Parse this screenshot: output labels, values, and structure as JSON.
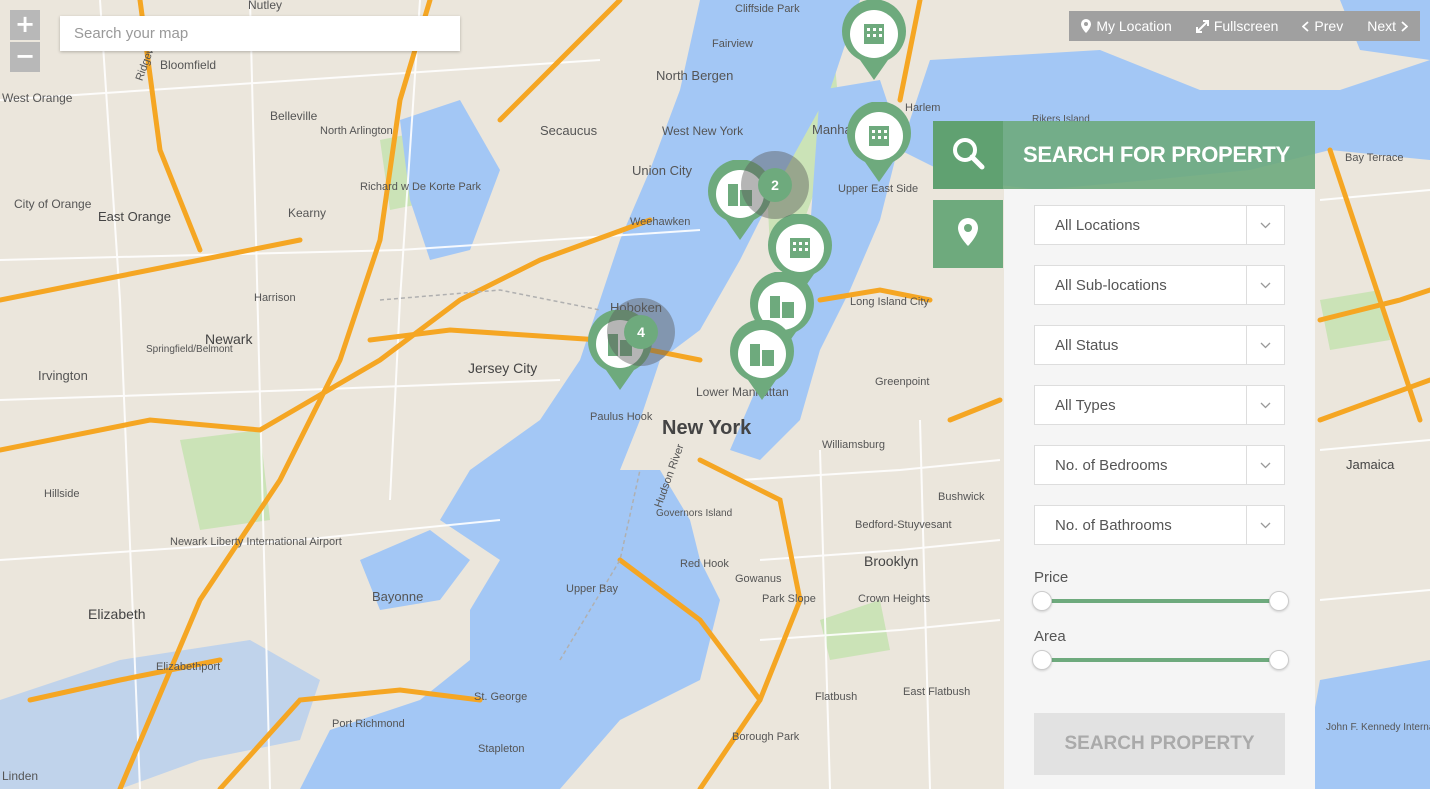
{
  "map": {
    "search_placeholder": "Search your map",
    "zoom_in": "+",
    "zoom_out": "−",
    "labels": [
      {
        "text": "New York",
        "size": 20,
        "bold": true,
        "cls": "city"
      },
      {
        "text": "Manhattan",
        "size": 13
      },
      {
        "text": "Brooklyn",
        "size": 14
      },
      {
        "text": "Jersey City",
        "size": 14
      },
      {
        "text": "Hoboken",
        "size": 13
      },
      {
        "text": "Newark",
        "size": 14
      },
      {
        "text": "Bayonne",
        "size": 13
      },
      {
        "text": "Elizabeth",
        "size": 14
      },
      {
        "text": "Union City",
        "size": 13
      },
      {
        "text": "Secaucus",
        "size": 13
      },
      {
        "text": "North Bergen",
        "size": 13
      },
      {
        "text": "West New York",
        "size": 12
      },
      {
        "text": "East Orange",
        "size": 13
      },
      {
        "text": "Bloomfield",
        "size": 12
      },
      {
        "text": "West Orange",
        "size": 12
      },
      {
        "text": "Irvington",
        "size": 13
      },
      {
        "text": "Kearny",
        "size": 12
      },
      {
        "text": "Harrison",
        "size": 11
      },
      {
        "text": "Belleville",
        "size": 12
      },
      {
        "text": "Nutley",
        "size": 12
      },
      {
        "text": "Fairview",
        "size": 11
      },
      {
        "text": "Cliffside Park",
        "size": 11
      },
      {
        "text": "Weehawken",
        "size": 11
      },
      {
        "text": "Lower Manhattan",
        "size": 12
      },
      {
        "text": "Williamsburg",
        "size": 11
      },
      {
        "text": "Greenpoint",
        "size": 11
      },
      {
        "text": "Long Island City",
        "size": 11
      },
      {
        "text": "Jamaica",
        "size": 13
      },
      {
        "text": "Red Hook",
        "size": 11
      },
      {
        "text": "Governors Island",
        "size": 10
      },
      {
        "text": "Upper Bay",
        "size": 11
      },
      {
        "text": "Newark Liberty International Airport",
        "size": 11
      },
      {
        "text": "John F. Kennedy International Airport",
        "size": 10
      },
      {
        "text": "Bedford-Stuyvesant",
        "size": 11
      },
      {
        "text": "Crown Heights",
        "size": 11
      },
      {
        "text": "Flatbush",
        "size": 11
      },
      {
        "text": "Park Slope",
        "size": 11
      },
      {
        "text": "Elizabethport",
        "size": 11
      },
      {
        "text": "Hillside",
        "size": 11
      },
      {
        "text": "Paulus Hook",
        "size": 11
      },
      {
        "text": "Upper East Side",
        "size": 11
      },
      {
        "text": "Harlem",
        "size": 11
      },
      {
        "text": "Rikers Island",
        "size": 10
      },
      {
        "text": "Port Richmond",
        "size": 11
      },
      {
        "text": "St. George",
        "size": 11
      },
      {
        "text": "Bay Terrace",
        "size": 11
      },
      {
        "text": "Richard w De Korte Park",
        "size": 11
      },
      {
        "text": "North Arlington",
        "size": 11
      },
      {
        "text": "City of Orange",
        "size": 12
      },
      {
        "text": "Springfield/Belmont",
        "size": 10
      },
      {
        "text": "Hudson River",
        "size": 11
      },
      {
        "text": "Linden",
        "size": 12
      },
      {
        "text": "Gowanus",
        "size": 11
      },
      {
        "text": "Bushwick",
        "size": 11
      },
      {
        "text": "East Flatbush",
        "size": 11
      },
      {
        "text": "Borough Park",
        "size": 11
      },
      {
        "text": "Ridgewood",
        "size": 11
      },
      {
        "text": "Stapleton",
        "size": 11
      }
    ],
    "clusters": [
      {
        "count": "2"
      },
      {
        "count": "4"
      }
    ]
  },
  "toolbar": {
    "my_location": "My Location",
    "fullscreen": "Fullscreen",
    "prev": "Prev",
    "next": "Next"
  },
  "search_panel": {
    "title": "SEARCH FOR PROPERTY",
    "selects": [
      {
        "label": "All Locations"
      },
      {
        "label": "All Sub-locations"
      },
      {
        "label": "All Status"
      },
      {
        "label": "All Types"
      },
      {
        "label": "No. of Bedrooms"
      },
      {
        "label": "No. of Bathrooms"
      }
    ],
    "price_label": "Price",
    "price_range": [
      0,
      1
    ],
    "area_label": "Area",
    "area_range": [
      0,
      1
    ],
    "submit": "SEARCH PROPERTY"
  },
  "colors": {
    "accent": "#6eaa7d",
    "water": "#a3c7f5",
    "land": "#e8e4d8",
    "park": "#c6e0b4",
    "highway": "#f5a623"
  }
}
